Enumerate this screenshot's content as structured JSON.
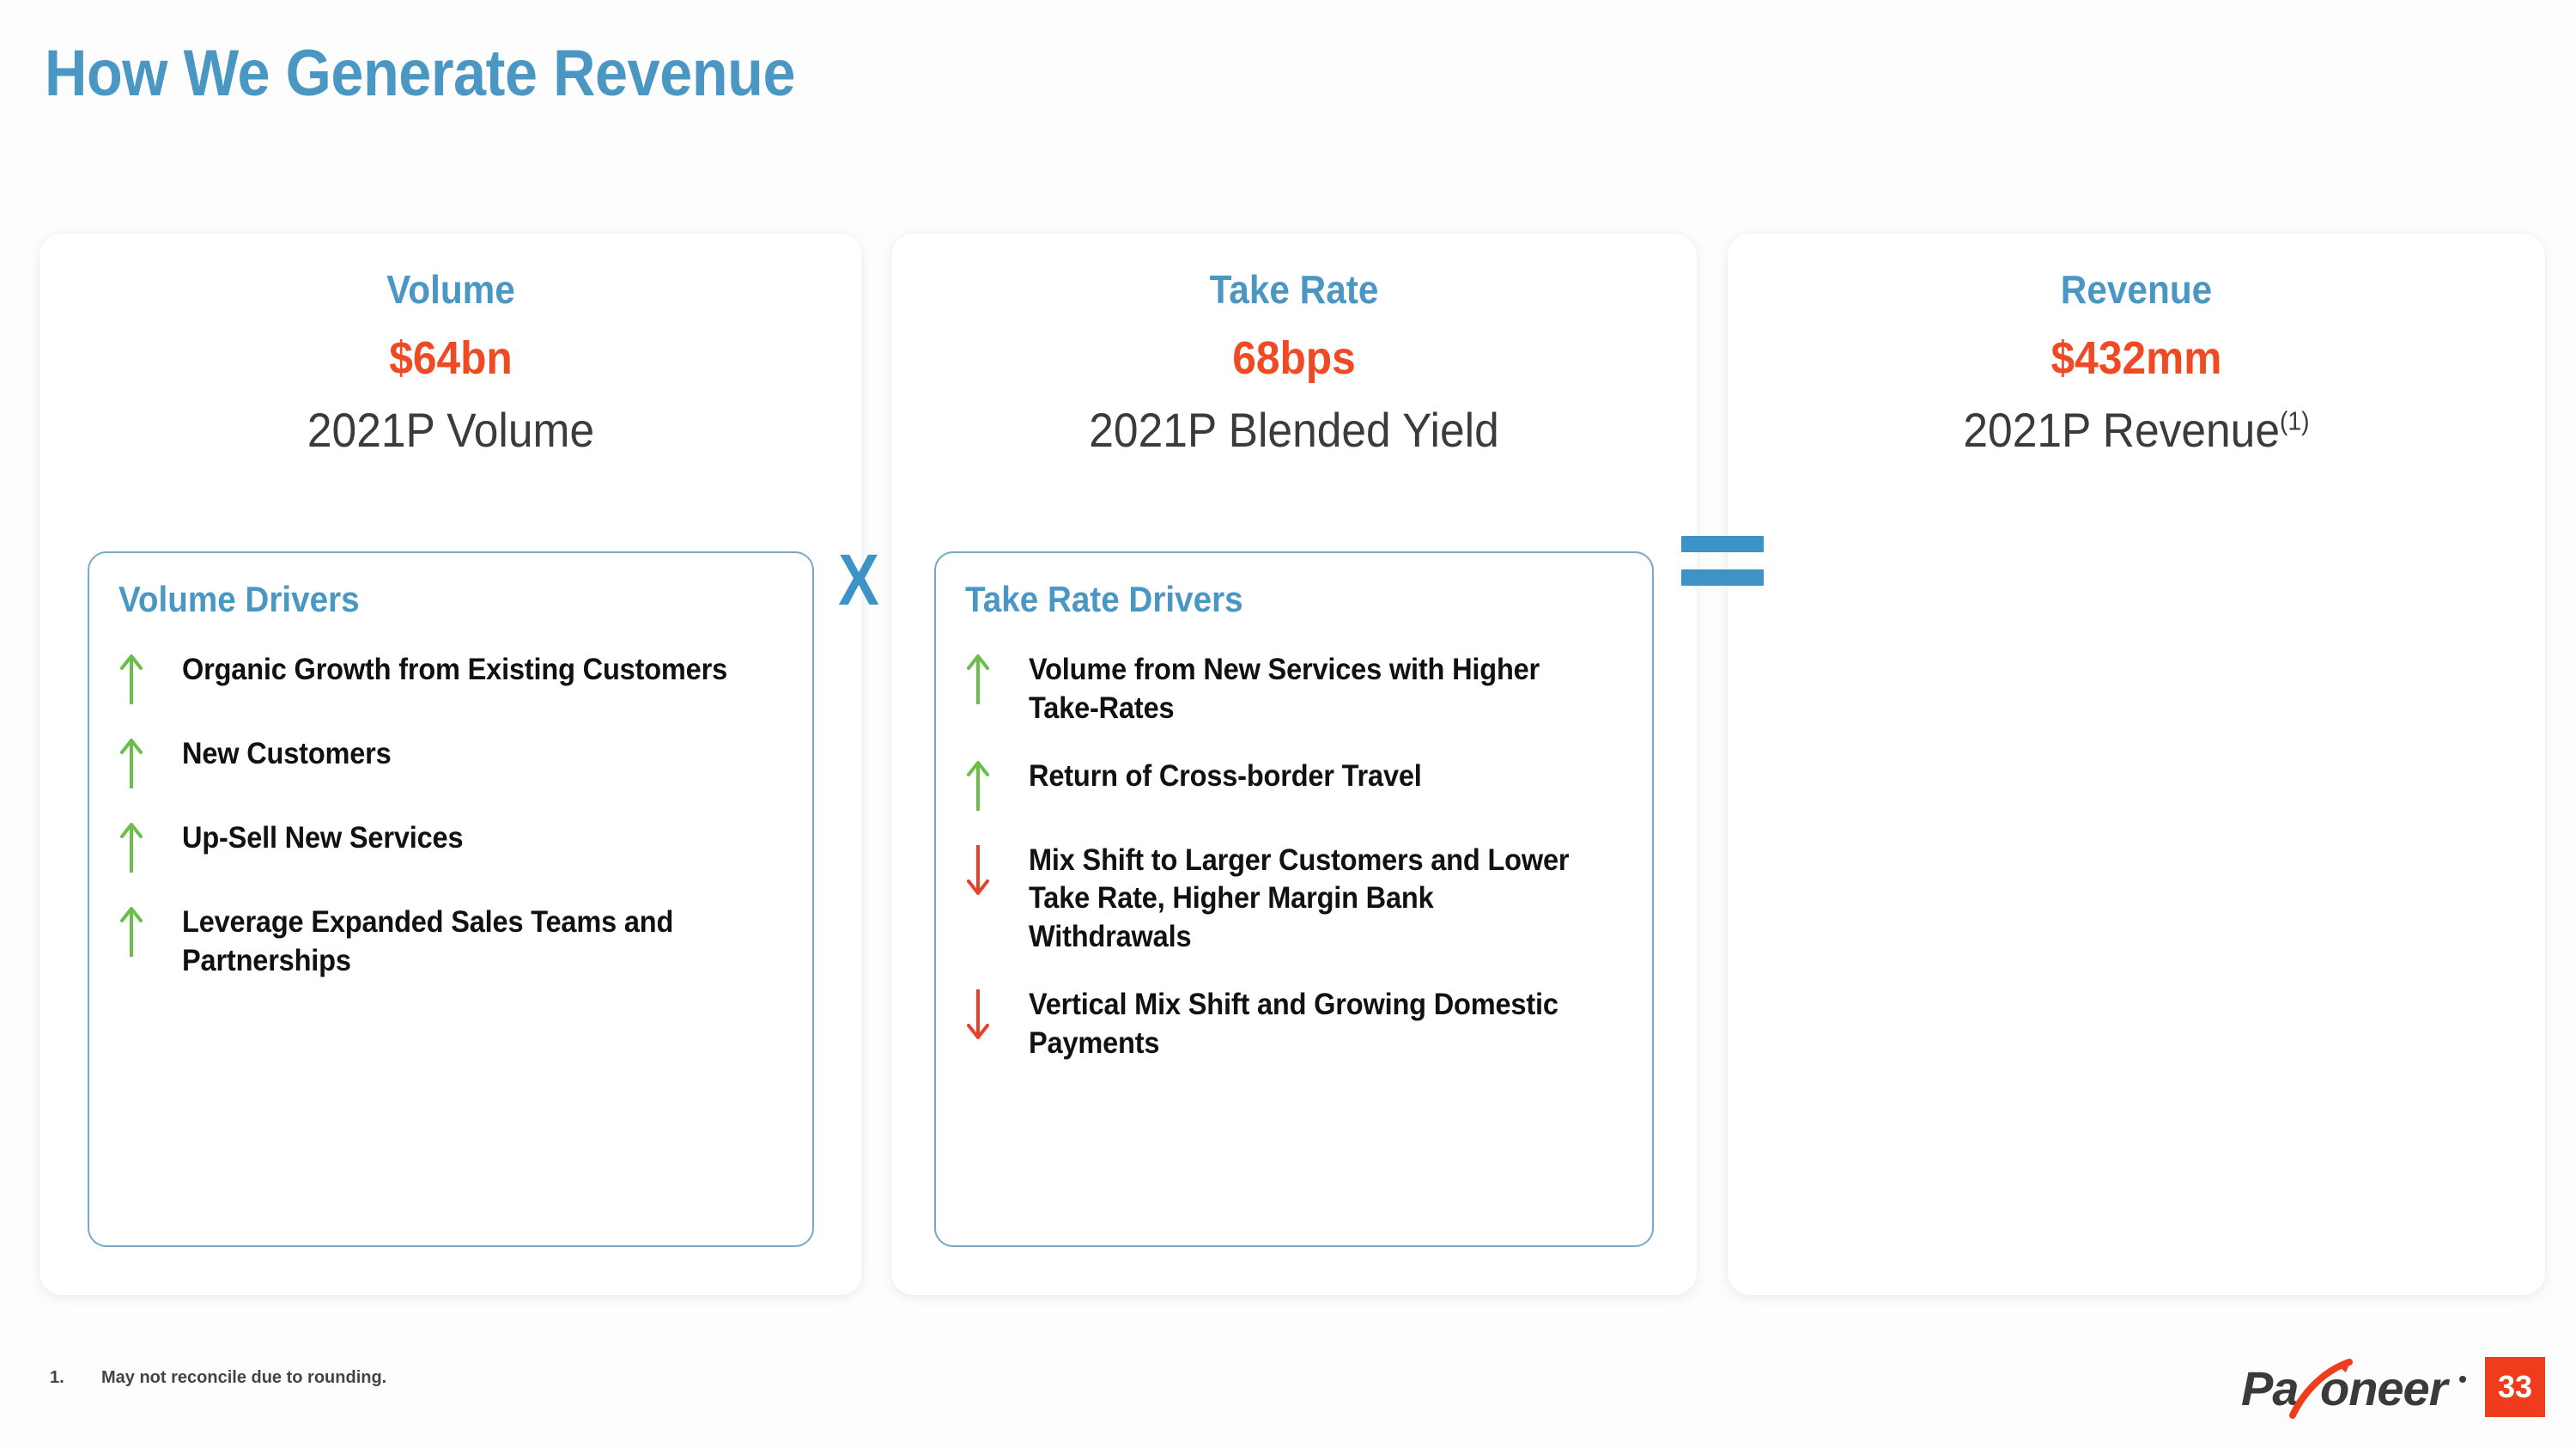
{
  "slide": {
    "title": "How We Generate Revenue",
    "title_color": "#4a97c4",
    "metric_color": "#ef4a23",
    "up_arrow_color": "#6abf4b",
    "down_arrow_color": "#e8402a",
    "box_border_color": "#76a9c5"
  },
  "operators": {
    "multiply": "X",
    "equals": "="
  },
  "cards": [
    {
      "kicker": "Volume",
      "metric": "$64bn",
      "caption": "2021P Volume",
      "caption_sup": "",
      "drivers_title": "Volume Drivers",
      "drivers": [
        {
          "direction": "up",
          "text": "Organic Growth from Existing Customers"
        },
        {
          "direction": "up",
          "text": "New Customers"
        },
        {
          "direction": "up",
          "text": "Up-Sell New Services"
        },
        {
          "direction": "up",
          "text": "Leverage Expanded Sales Teams and Partnerships"
        }
      ]
    },
    {
      "kicker": "Take Rate",
      "metric": "68bps",
      "caption": "2021P Blended Yield",
      "caption_sup": "",
      "drivers_title": "Take Rate Drivers",
      "drivers": [
        {
          "direction": "up",
          "text": "Volume from New Services with Higher Take-Rates"
        },
        {
          "direction": "up",
          "text": "Return of Cross-border Travel"
        },
        {
          "direction": "down",
          "text": "Mix Shift to Larger Customers and Lower Take Rate, Higher Margin Bank Withdrawals"
        },
        {
          "direction": "down",
          "text": "Vertical Mix Shift and Growing Domestic Payments"
        }
      ]
    },
    {
      "kicker": "Revenue",
      "metric": "$432mm",
      "caption": "2021P Revenue",
      "caption_sup": "(1)",
      "drivers_title": "",
      "drivers": []
    }
  ],
  "footer": {
    "footnote_number": "1.",
    "footnote_text": "May not reconcile due to rounding.",
    "logo_text": "Payoneer",
    "page_number": "33",
    "page_badge_color": "#ee3c1c"
  }
}
